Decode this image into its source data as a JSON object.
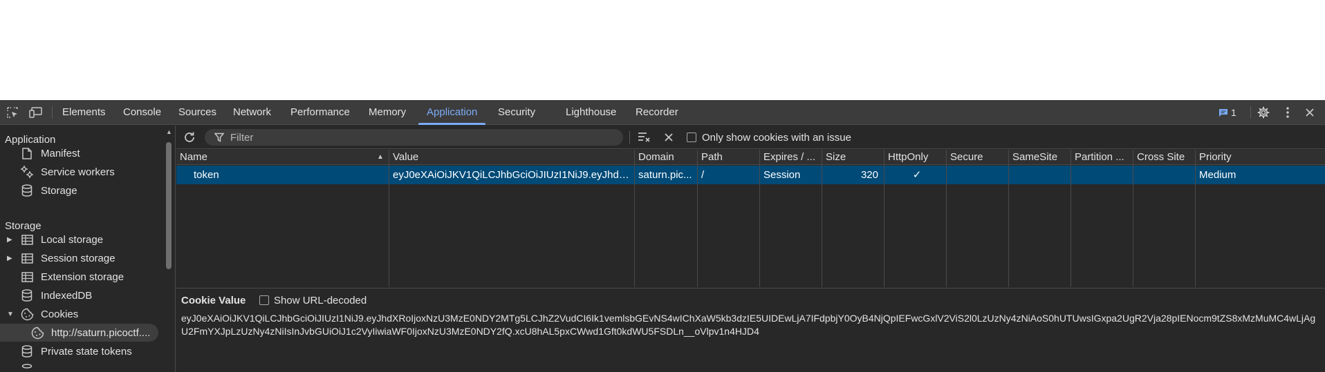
{
  "tabs": [
    {
      "label": "Elements"
    },
    {
      "label": "Console"
    },
    {
      "label": "Sources"
    },
    {
      "label": "Network"
    },
    {
      "label": "Performance"
    },
    {
      "label": "Memory"
    },
    {
      "label": "Application",
      "active": true
    },
    {
      "label": "Security"
    },
    {
      "label": "Lighthouse"
    },
    {
      "label": "Recorder"
    }
  ],
  "issues_count": "1",
  "colors": {
    "accent": "#7cacf8",
    "selected_row": "#004a77",
    "panel_bg": "#282828",
    "toolbar_bg": "#3c3c3c"
  },
  "sidebar": {
    "application_header": "Application",
    "application_items": [
      {
        "label": "Manifest",
        "icon": "file-icon"
      },
      {
        "label": "Service workers",
        "icon": "gears-icon"
      },
      {
        "label": "Storage",
        "icon": "database-icon"
      }
    ],
    "storage_header": "Storage",
    "storage_items": [
      {
        "label": "Local storage",
        "icon": "grid-icon",
        "expandable": true
      },
      {
        "label": "Session storage",
        "icon": "grid-icon",
        "expandable": true
      },
      {
        "label": "Extension storage",
        "icon": "grid-icon"
      },
      {
        "label": "IndexedDB",
        "icon": "database-icon"
      },
      {
        "label": "Cookies",
        "icon": "cookie-icon",
        "expanded": true
      },
      {
        "label": "http://saturn.picoctf....",
        "icon": "cookie-icon",
        "selected": true
      },
      {
        "label": "Private state tokens",
        "icon": "database-icon"
      }
    ]
  },
  "toolbar": {
    "filter_placeholder": "Filter",
    "only_issues_label": "Only show cookies with an issue"
  },
  "table": {
    "columns": [
      "Name",
      "Value",
      "Domain",
      "Path",
      "Expires / ...",
      "Size",
      "HttpOnly",
      "Secure",
      "SameSite",
      "Partition ...",
      "Cross Site",
      "Priority"
    ],
    "rows": [
      {
        "name": "token",
        "value": "eyJ0eXAiOiJKV1QiLCJhbGciOiJIUzI1NiJ9.eyJhdXRoIjoxNzU3Mz...",
        "domain": "saturn.pic...",
        "path": "/",
        "expires": "Session",
        "size": "320",
        "httponly": "✓",
        "secure": "",
        "samesite": "",
        "partition": "",
        "crosssite": "",
        "priority": "Medium"
      }
    ]
  },
  "cookie_value": {
    "title": "Cookie Value",
    "decode_label": "Show URL-decoded",
    "text": "eyJ0eXAiOiJKV1QiLCJhbGciOiJIUzI1NiJ9.eyJhdXRoIjoxNzU3MzE0NDY2MTg5LCJhZ2VudCI6Ik1vemlsbGEvNS4wIChXaW5kb3dzIE5UIDEwLjA7IFdpbjY0OyB4NjQpIEFwcGxlV2ViS2l0LzUzNy4zNiAoS0hUTUwsIGxpa2UgR2Vja28pIENocm9tZS8xMzMuMC4wLjAgU2FmYXJpLzUzNy4zNiIsInJvbGUiOiJ1c2VyIiwiaWF0IjoxNzU3MzE0NDY2fQ.xcU8hAL5pxCWwd1Gft0kdWU5FSDLn__oVlpv1n4HJD4"
  }
}
